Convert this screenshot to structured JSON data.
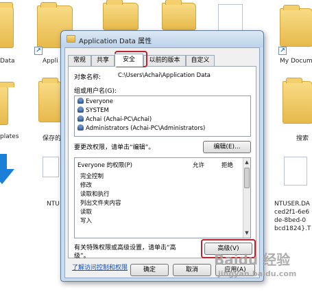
{
  "background": {
    "labels": {
      "data": "Data",
      "appl": "Appli",
      "my_docs": "My Docum",
      "plates": "plates",
      "baocun": "保存的",
      "sousuo": "搜索",
      "ntu": "NTU",
      "ntuser": "NTUSER.DA",
      "ced": "ced2f1-6e6",
      "de8": "de-8bed-0",
      "bcd": "bcd1824}.T",
      "shortcut_glyph": "↗"
    },
    "accent_folder": "#f3cf6d"
  },
  "dialog": {
    "title": "Application Data 属性",
    "tabs": [
      "常规",
      "共享",
      "安全",
      "以前的版本",
      "自定义"
    ],
    "active_tab": "安全",
    "object_label": "对象名称:",
    "object_value": "C:\\Users\\Achai\\Application Data",
    "groups_label": "组或用户名(G):",
    "users": [
      "Everyone",
      "SYSTEM",
      "Achai (Achai-PC\\Achai)",
      "Administrators (Achai-PC\\Administrators)"
    ],
    "edit_hint": "要更改权限，请单击“编辑”。",
    "edit_button": "编辑(E)...",
    "perm_title": "Everyone 的权限(P)",
    "allow_col": "允许",
    "deny_col": "拒绝",
    "permissions": [
      "完全控制",
      "修改",
      "读取和执行",
      "列出文件夹内容",
      "读取",
      "写入"
    ],
    "advanced_hint_1": "有关特殊权限或高级设置，请单击“高",
    "advanced_hint_2": "级”。",
    "advanced_button": "高级(V)",
    "help_link": "了解访问控制和权限",
    "ok_button": "确定",
    "cancel_button": "取消",
    "apply_button": "应用(A)"
  },
  "watermark": {
    "brand": "Baidu 经验",
    "url": "jingyan.baidu.com"
  },
  "highlight_color": "#c0202b"
}
